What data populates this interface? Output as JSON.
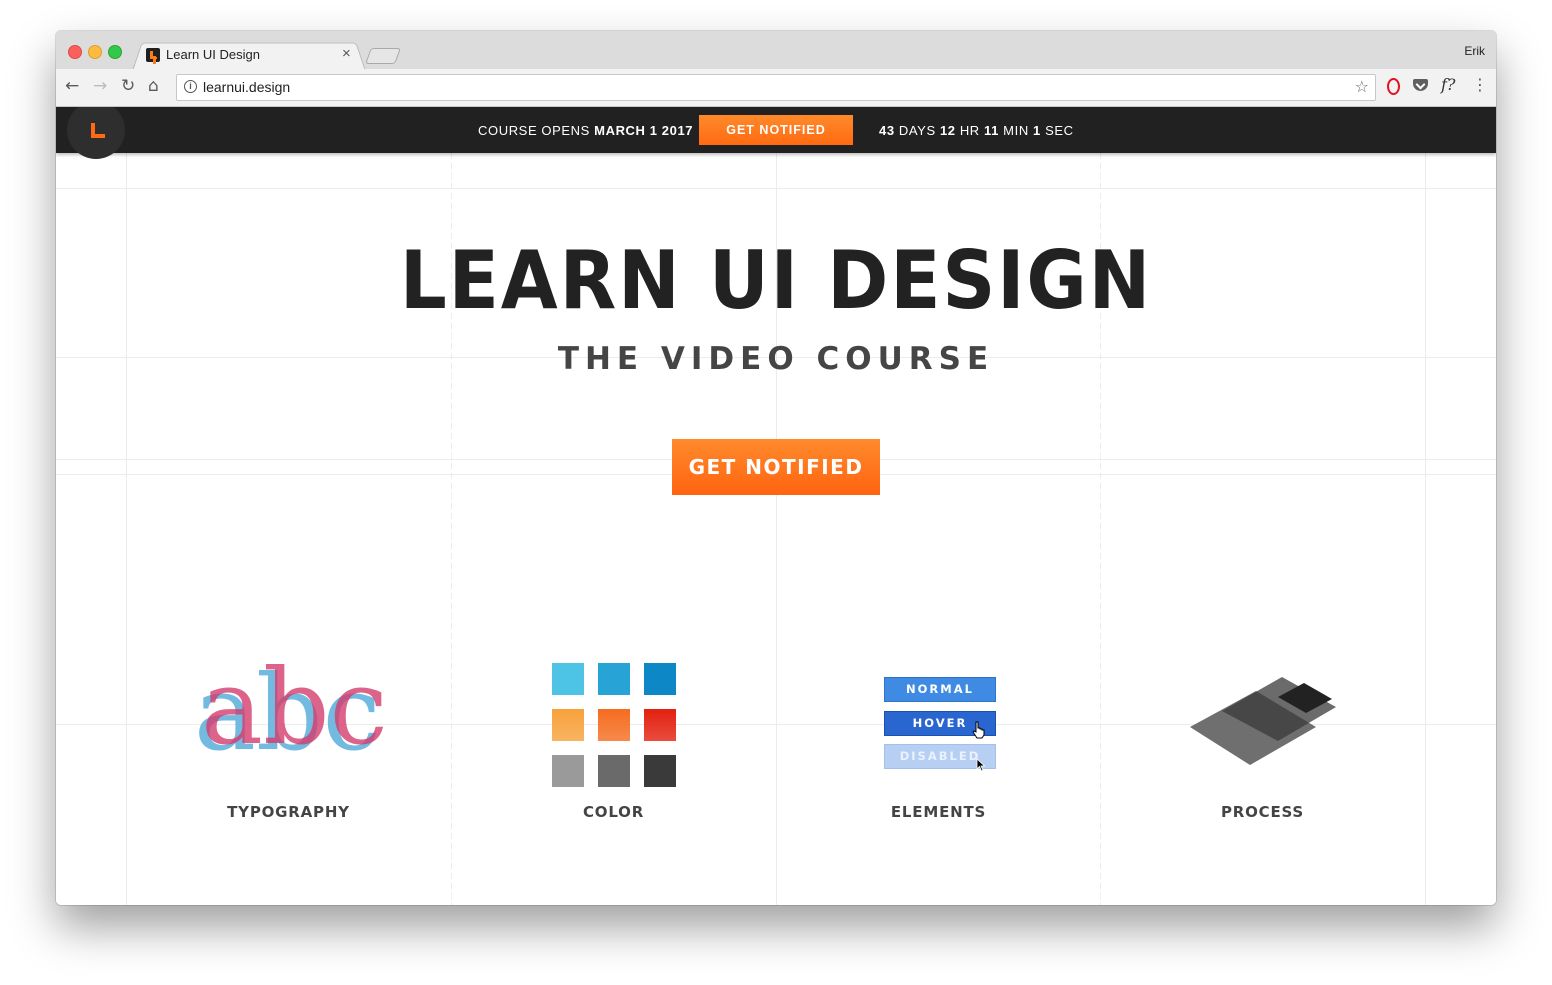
{
  "browser": {
    "tab_title": "Learn UI Design",
    "tab_close": "×",
    "profile_name": "Erik",
    "url": "learnui.design",
    "info_glyph": "i",
    "star_glyph": "☆",
    "ext_f_label": "f?",
    "menu_glyph": "⋮"
  },
  "header": {
    "promo_prefix": "COURSE OPENS ",
    "promo_date": "MARCH 1 2017",
    "button_label": "GET NOTIFIED",
    "countdown": {
      "days": "43",
      "days_unit": " DAYS ",
      "hours": "12",
      "hours_unit": " HR ",
      "minutes": "11",
      "minutes_unit": " MIN ",
      "seconds": "1",
      "seconds_unit": " SEC"
    },
    "accent_color": "#ff6a13"
  },
  "hero": {
    "title": "LEARN UI DESIGN",
    "subtitle": "THE VIDEO COURSE",
    "cta_label": "GET NOTIFIED"
  },
  "features": {
    "typography": {
      "label": "TYPOGRAPHY",
      "sample_text": "abc"
    },
    "color": {
      "label": "COLOR",
      "swatches": [
        [
          "#4dc3e6",
          "#27a3d6",
          "#0d87c6"
        ],
        [
          "#f7a13b",
          "#f56c1f",
          "#e3200f"
        ],
        [
          "#9a9a9a",
          "#6a6a6a",
          "#3a3a3a"
        ]
      ]
    },
    "elements": {
      "label": "ELEMENTS",
      "normal_label": "NORMAL",
      "hover_label": "HOVER",
      "disabled_label": "DISABLED"
    },
    "process": {
      "label": "PROCESS"
    }
  }
}
